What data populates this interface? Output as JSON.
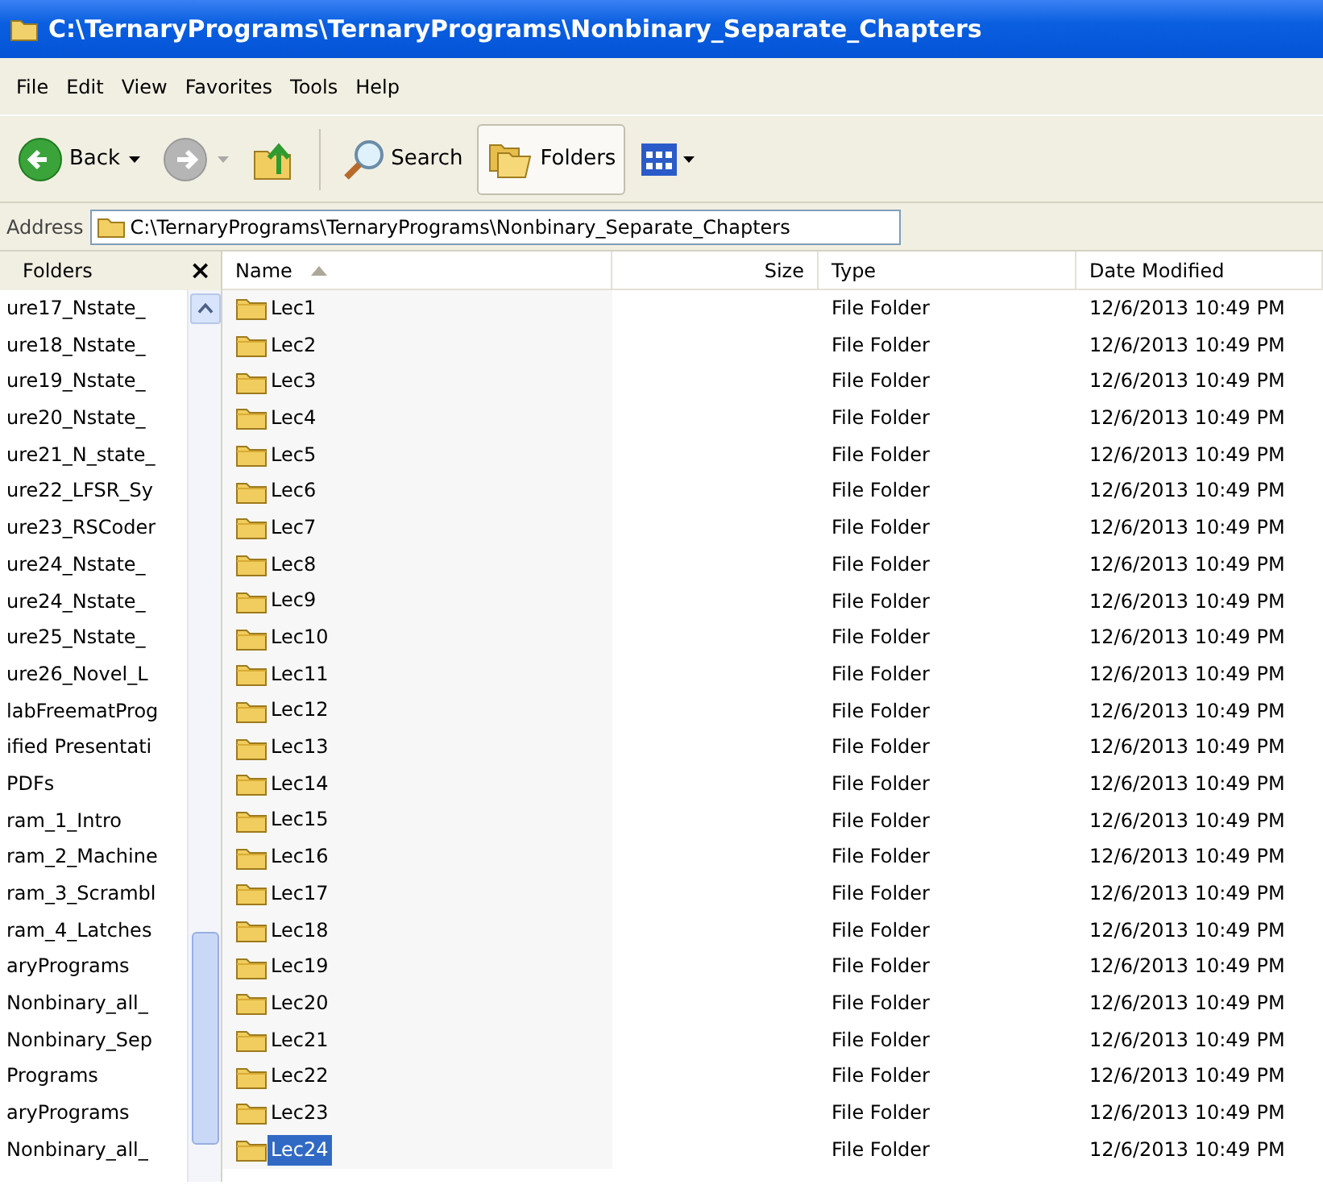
{
  "window": {
    "title": "C:\\TernaryPrograms\\TernaryPrograms\\Nonbinary_Separate_Chapters"
  },
  "menu": [
    {
      "label": "File"
    },
    {
      "label": "Edit"
    },
    {
      "label": "View"
    },
    {
      "label": "Favorites"
    },
    {
      "label": "Tools"
    },
    {
      "label": "Help"
    }
  ],
  "toolbar": [
    {
      "kind": "back",
      "label": "Back",
      "dropdown": true
    },
    {
      "kind": "forward",
      "disabled": true,
      "dropdown": true
    },
    {
      "kind": "up"
    },
    {
      "kind": "search",
      "label": "Search",
      "selected": false
    },
    {
      "kind": "folders",
      "label": "Folders",
      "selected": true
    },
    {
      "kind": "views",
      "dropdown": true
    }
  ],
  "address": {
    "label": "Address",
    "value": "C:\\TernaryPrograms\\TernaryPrograms\\Nonbinary_Separate_Chapters"
  },
  "folders_pane": {
    "title": "Folders",
    "close": "×",
    "items": [
      {
        "label": "ure17_Nstate_"
      },
      {
        "label": "ure18_Nstate_"
      },
      {
        "label": "ure19_Nstate_"
      },
      {
        "label": "ure20_Nstate_"
      },
      {
        "label": "ure21_N_state_"
      },
      {
        "label": "ure22_LFSR_Sy"
      },
      {
        "label": "ure23_RSCoder"
      },
      {
        "label": "ure24_Nstate_"
      },
      {
        "label": "ure24_Nstate_"
      },
      {
        "label": "ure25_Nstate_"
      },
      {
        "label": "ure26_Novel_L"
      },
      {
        "label": "labFreematProg"
      },
      {
        "label": "ified Presentati"
      },
      {
        "label": "PDFs"
      },
      {
        "label": "ram_1_Intro"
      },
      {
        "label": "ram_2_Machine"
      },
      {
        "label": "ram_3_Scrambl"
      },
      {
        "label": "ram_4_Latches"
      },
      {
        "label": "aryPrograms"
      },
      {
        "label": "Nonbinary_all_"
      },
      {
        "label": "Nonbinary_Sep"
      },
      {
        "label": "Programs"
      },
      {
        "label": "aryPrograms"
      },
      {
        "label": "Nonbinary_all_"
      }
    ]
  },
  "table": {
    "columns": [
      {
        "label": "Name",
        "sorted": true
      },
      {
        "label": "Size",
        "sorted": false
      },
      {
        "label": "Type",
        "sorted": false
      },
      {
        "label": "Date Modified",
        "sorted": false
      }
    ],
    "rows": [
      {
        "name": "Lec1",
        "type": "File Folder",
        "date_modified": "12/6/2013 10:49 PM",
        "selected": false
      },
      {
        "name": "Lec2",
        "type": "File Folder",
        "date_modified": "12/6/2013 10:49 PM",
        "selected": false
      },
      {
        "name": "Lec3",
        "type": "File Folder",
        "date_modified": "12/6/2013 10:49 PM",
        "selected": false
      },
      {
        "name": "Lec4",
        "type": "File Folder",
        "date_modified": "12/6/2013 10:49 PM",
        "selected": false
      },
      {
        "name": "Lec5",
        "type": "File Folder",
        "date_modified": "12/6/2013 10:49 PM",
        "selected": false
      },
      {
        "name": "Lec6",
        "type": "File Folder",
        "date_modified": "12/6/2013 10:49 PM",
        "selected": false
      },
      {
        "name": "Lec7",
        "type": "File Folder",
        "date_modified": "12/6/2013 10:49 PM",
        "selected": false
      },
      {
        "name": "Lec8",
        "type": "File Folder",
        "date_modified": "12/6/2013 10:49 PM",
        "selected": false
      },
      {
        "name": "Lec9",
        "type": "File Folder",
        "date_modified": "12/6/2013 10:49 PM",
        "selected": false
      },
      {
        "name": "Lec10",
        "type": "File Folder",
        "date_modified": "12/6/2013 10:49 PM",
        "selected": false
      },
      {
        "name": "Lec11",
        "type": "File Folder",
        "date_modified": "12/6/2013 10:49 PM",
        "selected": false
      },
      {
        "name": "Lec12",
        "type": "File Folder",
        "date_modified": "12/6/2013 10:49 PM",
        "selected": false
      },
      {
        "name": "Lec13",
        "type": "File Folder",
        "date_modified": "12/6/2013 10:49 PM",
        "selected": false
      },
      {
        "name": "Lec14",
        "type": "File Folder",
        "date_modified": "12/6/2013 10:49 PM",
        "selected": false
      },
      {
        "name": "Lec15",
        "type": "File Folder",
        "date_modified": "12/6/2013 10:49 PM",
        "selected": false
      },
      {
        "name": "Lec16",
        "type": "File Folder",
        "date_modified": "12/6/2013 10:49 PM",
        "selected": false
      },
      {
        "name": "Lec17",
        "type": "File Folder",
        "date_modified": "12/6/2013 10:49 PM",
        "selected": false
      },
      {
        "name": "Lec18",
        "type": "File Folder",
        "date_modified": "12/6/2013 10:49 PM",
        "selected": false
      },
      {
        "name": "Lec19",
        "type": "File Folder",
        "date_modified": "12/6/2013 10:49 PM",
        "selected": false
      },
      {
        "name": "Lec20",
        "type": "File Folder",
        "date_modified": "12/6/2013 10:49 PM",
        "selected": false
      },
      {
        "name": "Lec21",
        "type": "File Folder",
        "date_modified": "12/6/2013 10:49 PM",
        "selected": false
      },
      {
        "name": "Lec22",
        "type": "File Folder",
        "date_modified": "12/6/2013 10:49 PM",
        "selected": false
      },
      {
        "name": "Lec23",
        "type": "File Folder",
        "date_modified": "12/6/2013 10:49 PM",
        "selected": false
      },
      {
        "name": "Lec24",
        "type": "File Folder",
        "date_modified": "12/6/2013 10:49 PM",
        "selected": true
      }
    ]
  }
}
